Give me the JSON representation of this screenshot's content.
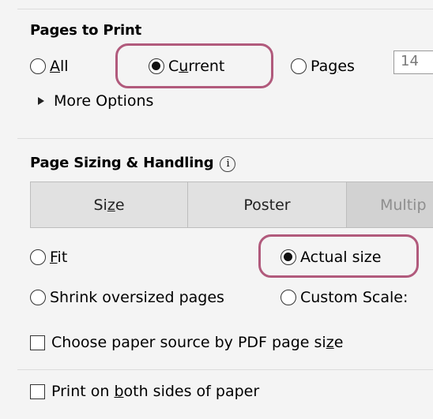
{
  "pages_to_print": {
    "title": "Pages to Print",
    "all": {
      "prefix": "",
      "mnemonic": "A",
      "suffix": "ll"
    },
    "current": {
      "prefix": "C",
      "mnemonic": "u",
      "suffix": "rrent"
    },
    "pages": {
      "prefix": "Pa",
      "mnemonic": "g",
      "suffix": "es"
    },
    "page_range_value": "14",
    "more_options": "More Options"
  },
  "page_sizing": {
    "title": "Page Sizing & Handling",
    "info_glyph": "i",
    "tabs": {
      "size": {
        "prefix": "Si",
        "mnemonic": "z",
        "suffix": "e"
      },
      "poster": "Poster",
      "multiple": "Multip"
    },
    "fit": {
      "prefix": "",
      "mnemonic": "F",
      "suffix": "it"
    },
    "actual_size": "Actual size",
    "shrink": "Shrink oversized pages",
    "custom_scale": "Custom Scale:",
    "paper_source": {
      "prefix": "Choose paper source by PDF page si",
      "mnemonic": "z",
      "suffix": "e"
    }
  },
  "duplex": {
    "prefix": "Print on ",
    "mnemonic": "b",
    "suffix": "oth sides of paper"
  },
  "colors": {
    "highlight": "#b15a7c"
  }
}
